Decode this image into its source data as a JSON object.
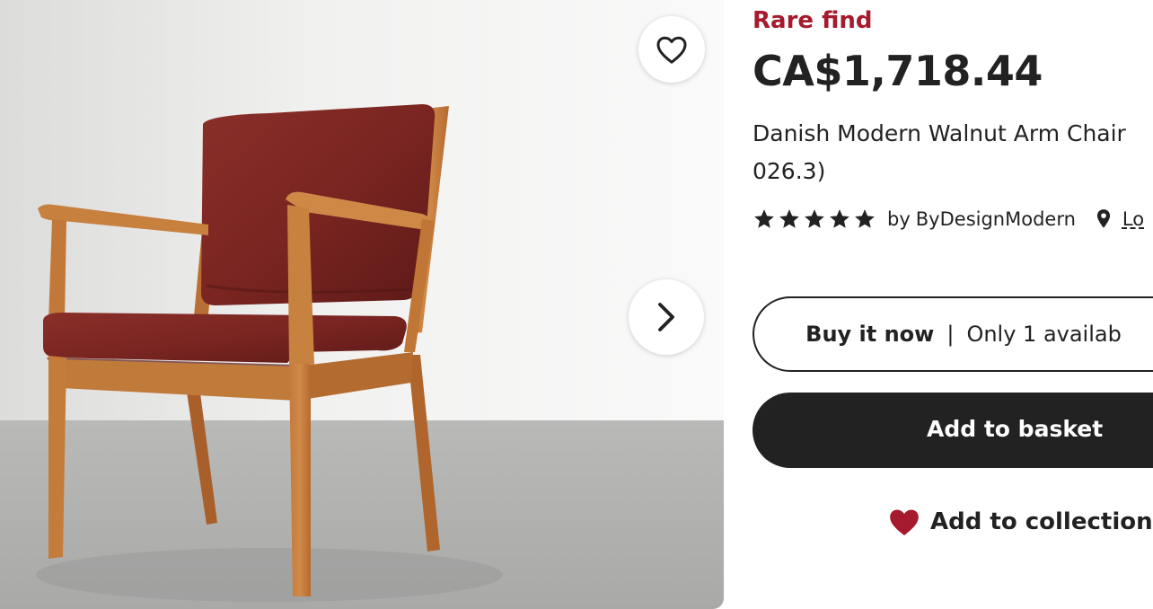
{
  "gallery": {
    "favorite_icon": "heart-outline-icon",
    "next_icon": "chevron-right-icon"
  },
  "listing": {
    "badge": "Rare find",
    "price": "CA$1,718.44",
    "title_line1": "Danish Modern Walnut Arm Chair",
    "title_line2": "026.3)"
  },
  "seller": {
    "rating": 5,
    "rating_max": 5,
    "by_label": "by",
    "shop_name": "ByDesignModern",
    "location_icon": "location-pin-icon",
    "location_link": "Lo"
  },
  "actions": {
    "buy_now_label": "Buy it now",
    "separator": "|",
    "availability": "Only 1 availab",
    "add_to_basket": "Add to basket",
    "add_to_collection": "Add to collection",
    "collection_icon": "heart-filled-icon"
  },
  "colors": {
    "badge": "#a61a2e",
    "heart": "#a61a2e",
    "primary_button": "#222222",
    "text": "#222222"
  }
}
